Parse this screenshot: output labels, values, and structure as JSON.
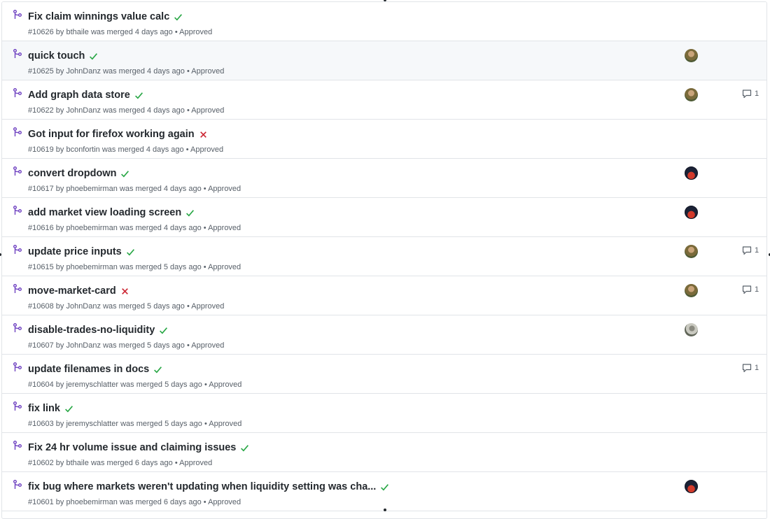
{
  "colors": {
    "merged": "#6f42c1",
    "success": "#28a745",
    "failure": "#cb2431"
  },
  "meta_words": {
    "merged_phrase": "was merged",
    "separator": "•"
  },
  "pull_requests": [
    {
      "title": "Fix claim winnings value calc",
      "status": "success",
      "number": "#10626",
      "author": "bthaile",
      "ago": "4 days ago",
      "review": "Approved",
      "avatar": null,
      "comments": null
    },
    {
      "title": "quick touch",
      "status": "success",
      "number": "#10625",
      "author": "JohnDanz",
      "ago": "4 days ago",
      "review": "Approved",
      "avatar": "brown",
      "comments": null
    },
    {
      "title": "Add graph data store",
      "status": "success",
      "number": "#10622",
      "author": "JohnDanz",
      "ago": "4 days ago",
      "review": "Approved",
      "avatar": "brown",
      "comments": "1"
    },
    {
      "title": "Got input for firefox working again",
      "status": "failure",
      "number": "#10619",
      "author": "bconfortin",
      "ago": "4 days ago",
      "review": "Approved",
      "avatar": null,
      "comments": null
    },
    {
      "title": "convert dropdown",
      "status": "success",
      "number": "#10617",
      "author": "phoebemirman",
      "ago": "4 days ago",
      "review": "Approved",
      "avatar": "dark",
      "comments": null
    },
    {
      "title": "add market view loading screen",
      "status": "success",
      "number": "#10616",
      "author": "phoebemirman",
      "ago": "4 days ago",
      "review": "Approved",
      "avatar": "dark",
      "comments": null
    },
    {
      "title": "update price inputs",
      "status": "success",
      "number": "#10615",
      "author": "phoebemirman",
      "ago": "5 days ago",
      "review": "Approved",
      "avatar": "brown",
      "comments": "1"
    },
    {
      "title": "move-market-card",
      "status": "failure",
      "number": "#10608",
      "author": "JohnDanz",
      "ago": "5 days ago",
      "review": "Approved",
      "avatar": "brown",
      "comments": "1"
    },
    {
      "title": "disable-trades-no-liquidity",
      "status": "success",
      "number": "#10607",
      "author": "JohnDanz",
      "ago": "5 days ago",
      "review": "Approved",
      "avatar": "grey",
      "comments": null
    },
    {
      "title": "update filenames in docs",
      "status": "success",
      "number": "#10604",
      "author": "jeremyschlatter",
      "ago": "5 days ago",
      "review": "Approved",
      "avatar": null,
      "comments": "1"
    },
    {
      "title": "fix link",
      "status": "success",
      "number": "#10603",
      "author": "jeremyschlatter",
      "ago": "5 days ago",
      "review": "Approved",
      "avatar": null,
      "comments": null
    },
    {
      "title": "Fix 24 hr volume issue and claiming issues",
      "status": "success",
      "number": "#10602",
      "author": "bthaile",
      "ago": "6 days ago",
      "review": "Approved",
      "avatar": null,
      "comments": null
    },
    {
      "title": "fix bug where markets weren't updating when liquidity setting was cha...",
      "status": "success",
      "number": "#10601",
      "author": "phoebemirman",
      "ago": "6 days ago",
      "review": "Approved",
      "avatar": "dark",
      "comments": null
    }
  ]
}
